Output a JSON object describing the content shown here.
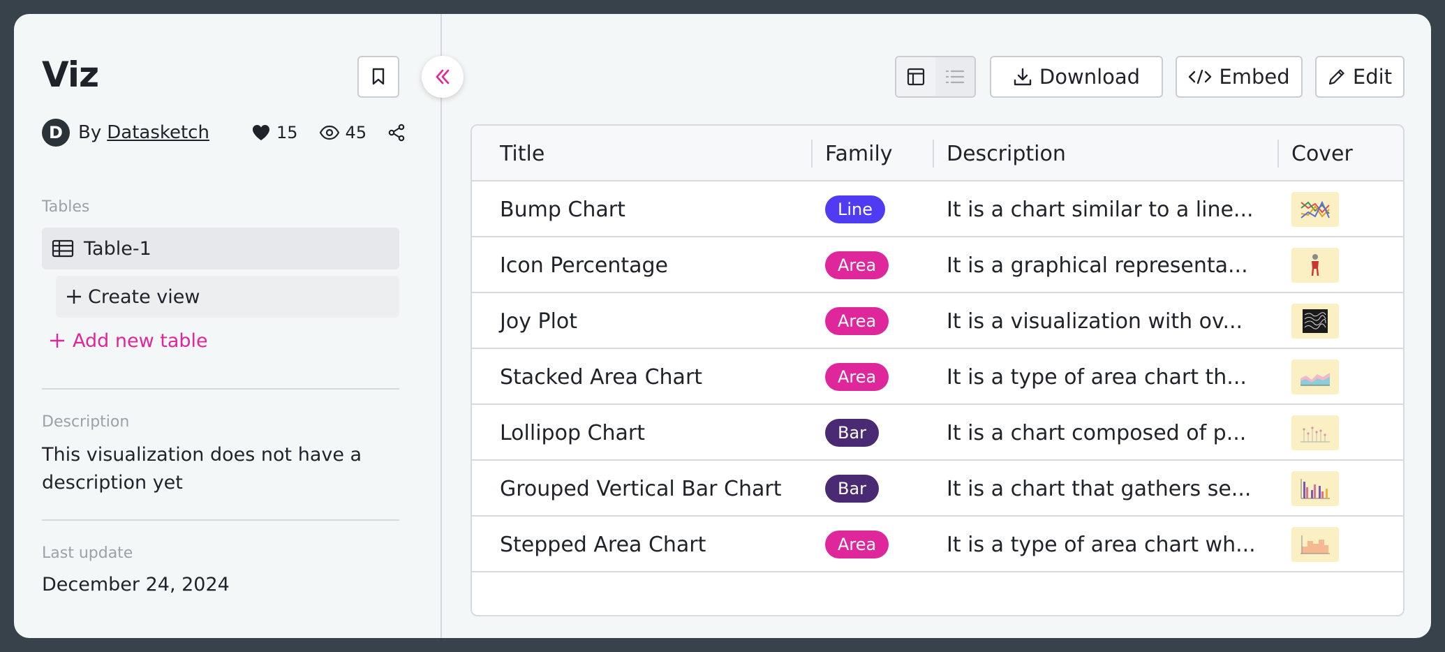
{
  "sidebar": {
    "title": "Viz",
    "author": {
      "avatar_letter": "D",
      "by_label": "By",
      "name": "Datasketch"
    },
    "stats": {
      "likes": "15",
      "views": "45"
    },
    "tables_label": "Tables",
    "tables": [
      {
        "label": "Table-1"
      }
    ],
    "create_view_label": "Create view",
    "add_table_label": "Add new table",
    "description_label": "Description",
    "description_text": "This visualization does not have a description yet",
    "last_update_label": "Last update",
    "last_update_value": "December 24, 2024"
  },
  "toolbar": {
    "download_label": "Download",
    "embed_label": "Embed",
    "edit_label": "Edit"
  },
  "table": {
    "columns": [
      "Title",
      "Family",
      "Description",
      "Cover"
    ],
    "rows": [
      {
        "title": "Bump Chart",
        "family": "Line",
        "description": "It is a chart similar to a line..."
      },
      {
        "title": "Icon Percentage",
        "family": "Area",
        "description": "It is a graphical representa..."
      },
      {
        "title": "Joy Plot",
        "family": "Area",
        "description": "It is a visualization with ov..."
      },
      {
        "title": "Stacked Area Chart",
        "family": "Area",
        "description": "It is a type of area chart th..."
      },
      {
        "title": "Lollipop Chart",
        "family": "Bar",
        "description": "It is a chart composed of p..."
      },
      {
        "title": "Grouped Vertical Bar Chart",
        "family": "Bar",
        "description": "It is a chart that gathers se..."
      },
      {
        "title": "Stepped Area Chart",
        "family": "Area",
        "description": "It is a type of area chart wh..."
      }
    ]
  },
  "colors": {
    "accent": "#e0269b",
    "badge_line": "#4f3bf2",
    "badge_area": "#e0269b",
    "badge_bar": "#4a2a73",
    "frame_border": "#37424a",
    "thumb_bg": "#fbf0c4"
  }
}
